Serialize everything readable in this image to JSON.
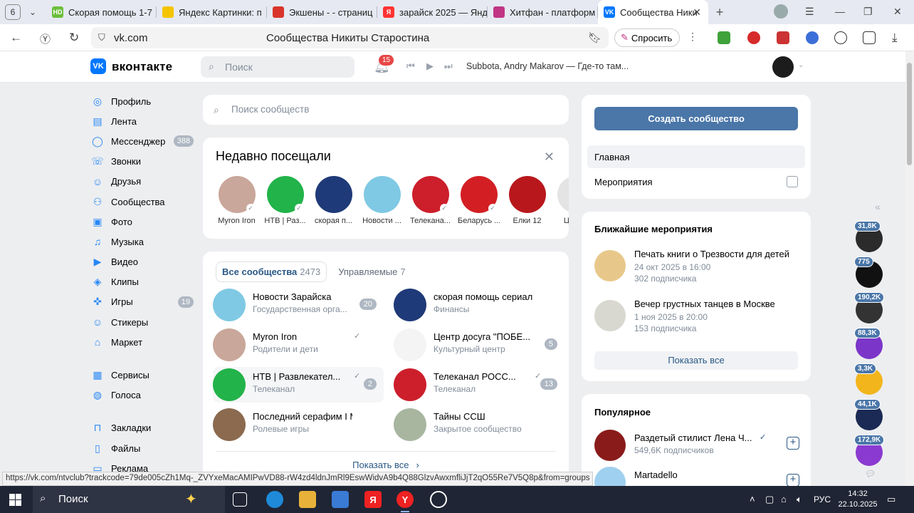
{
  "browser": {
    "tab_count": "6",
    "tabs": [
      {
        "label": "Скорая помощь 1-7",
        "fav": "HD",
        "color": "#6cbf3c"
      },
      {
        "label": "Яндекс Картинки: п",
        "fav": "",
        "color": "#f5c400"
      },
      {
        "label": "Экшены - - страниц",
        "fav": "",
        "color": "#d9342b"
      },
      {
        "label": "зарайск 2025 — Янд",
        "fav": "Я",
        "color": "#f33"
      },
      {
        "label": "Хитфан - платформ",
        "fav": "",
        "color": "#c13584"
      },
      {
        "label": "Сообщества Ники",
        "fav": "VK",
        "color": "#0077ff"
      }
    ],
    "url_host": "vk.com",
    "page_title": "Сообщества Никиты Старостина",
    "ask_label": "Спросить",
    "status_url": "https://vk.com/ntvclub?trackcode=79de005cZh1Mq-_ZVYxeMacAMIPwVD88-rW4zd4ldnJmRl9EswWidvA9b4Q88GlzvAwxmfliJjT2qO55Re7V5Q8p&from=groups"
  },
  "vk": {
    "brand": "вконтакте",
    "search_placeholder": "Поиск",
    "notif_count": "15",
    "track": "Subbota, Andry Makarov — Где-то там...",
    "menu": [
      {
        "label": "Профиль",
        "icon": "profile-icon",
        "glyph": "◎"
      },
      {
        "label": "Лента",
        "icon": "feed-icon",
        "glyph": "▤"
      },
      {
        "label": "Мессенджер",
        "icon": "messenger-icon",
        "glyph": "◯",
        "count": "388"
      },
      {
        "label": "Звонки",
        "icon": "phone-icon",
        "glyph": "☏"
      },
      {
        "label": "Друзья",
        "icon": "friends-icon",
        "glyph": "☺"
      },
      {
        "label": "Сообщества",
        "icon": "communities-icon",
        "glyph": "⚇"
      },
      {
        "label": "Фото",
        "icon": "photo-icon",
        "glyph": "▣"
      },
      {
        "label": "Музыка",
        "icon": "music-icon",
        "glyph": "♫"
      },
      {
        "label": "Видео",
        "icon": "video-icon",
        "glyph": "▶"
      },
      {
        "label": "Клипы",
        "icon": "clips-icon",
        "glyph": "◈"
      },
      {
        "label": "Игры",
        "icon": "games-icon",
        "glyph": "✜",
        "count": "19"
      },
      {
        "label": "Стикеры",
        "icon": "stickers-icon",
        "glyph": "☺"
      },
      {
        "label": "Маркет",
        "icon": "market-icon",
        "glyph": "⌂"
      }
    ],
    "menu2": [
      {
        "label": "Сервисы",
        "icon": "services-icon",
        "glyph": "▦"
      },
      {
        "label": "Голоса",
        "icon": "votes-icon",
        "glyph": "◍"
      }
    ],
    "menu3": [
      {
        "label": "Закладки",
        "icon": "bookmarks-icon",
        "glyph": "⊓"
      },
      {
        "label": "Файлы",
        "icon": "files-icon",
        "glyph": "▯"
      },
      {
        "label": "Реклама",
        "icon": "ads-icon",
        "glyph": "▭"
      }
    ]
  },
  "center": {
    "search_placeholder": "Поиск сообществ",
    "recent_title": "Недавно посещали",
    "recent": [
      {
        "name": "Myron Iron",
        "color": "#c9a79a",
        "verified": true
      },
      {
        "name": "НТВ | Раз...",
        "color": "#22b34a",
        "verified": true
      },
      {
        "name": "скорая п...",
        "color": "#1f3a78"
      },
      {
        "name": "Новости ...",
        "color": "#7fc9e4"
      },
      {
        "name": "Телекана...",
        "color": "#cc1f2b",
        "verified": true
      },
      {
        "name": "Беларусь ...",
        "color": "#d31f24",
        "verified": true
      },
      {
        "name": "Елки 12",
        "color": "#b8181c"
      },
      {
        "name": "Цент...",
        "color": "#e4e4e4"
      }
    ],
    "tab_all": "Все сообщества",
    "tab_all_count": "2473",
    "tab_managed": "Управляемые",
    "tab_managed_count": "7",
    "groups_left": [
      {
        "name": "Новости Зарайска",
        "sub": "Государственная орга...",
        "count": "20",
        "color": "#7fc9e4"
      },
      {
        "name": "Myron Iron",
        "sub": "Родители и дети",
        "verified": true,
        "color": "#c9a79a"
      },
      {
        "name": "НТВ | Развлекател...",
        "sub": "Телеканал",
        "verified": true,
        "count": "2",
        "color": "#22b34a"
      },
      {
        "name": "Последний серафим I M...",
        "sub": "Ролевые игры",
        "color": "#8b6a4f"
      }
    ],
    "groups_right": [
      {
        "name": "скорая помощь сериал",
        "sub": "Финансы",
        "color": "#1f3a78"
      },
      {
        "name": "Центр досуга \"ПОБЕ...",
        "sub": "Культурный центр",
        "count": "5",
        "color": "#f4f4f4"
      },
      {
        "name": "Телеканал РОСС...",
        "sub": "Телеканал",
        "verified": true,
        "count": "13",
        "color": "#cc1f2b"
      },
      {
        "name": "Тайны ССШ",
        "sub": "Закрытое сообщество",
        "color": "#a8b6a0"
      }
    ],
    "show_all": "Показать все"
  },
  "right": {
    "create_label": "Создать сообщество",
    "nav_main": "Главная",
    "nav_events": "Мероприятия",
    "events_title": "Ближайшие мероприятия",
    "events": [
      {
        "title": "Печать книги о Трезвости для детей",
        "date": "24 окт 2025 в 16:00",
        "subs": "302 подписчика",
        "color": "#e8c88a"
      },
      {
        "title": "Вечер грустных танцев в Москве",
        "date": "1 ноя 2025 в 20:00",
        "subs": "153 подписчика",
        "color": "#d8d8d0"
      }
    ],
    "events_show_all": "Показать все",
    "popular_title": "Популярное",
    "popular": [
      {
        "title": "Раздетый стилист Лена Ч...",
        "subs": "549,6K подписчиков",
        "verified": true,
        "color": "#8a1b1b"
      },
      {
        "title": "Martadello",
        "subs": "",
        "color": "#9fd0ef"
      }
    ]
  },
  "far_right": [
    {
      "badge": "31,8K",
      "color": "#2b2b2b"
    },
    {
      "badge": "775",
      "color": "#111111"
    },
    {
      "badge": "190,2K",
      "color": "#333333"
    },
    {
      "badge": "88,3K",
      "color": "#7b35c9"
    },
    {
      "badge": "3,3K",
      "color": "#f2b51c"
    },
    {
      "badge": "44,1K",
      "color": "#1a2a55"
    },
    {
      "badge": "172,9K",
      "color": "#8a3ad1"
    }
  ],
  "taskbar": {
    "search_label": "Поиск",
    "lang": "РУС",
    "time": "14:32",
    "date": "22.10.2025"
  }
}
